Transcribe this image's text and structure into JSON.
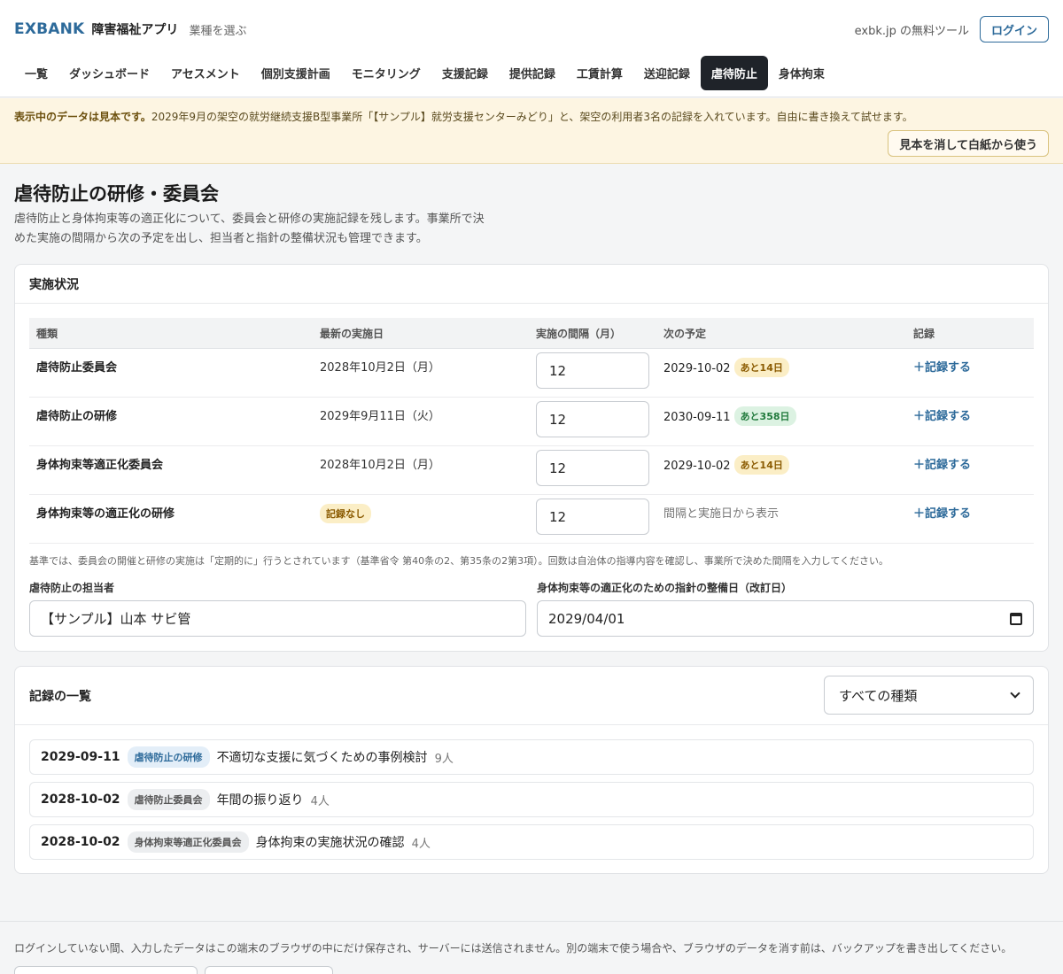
{
  "header": {
    "logo": "EXBANK",
    "app_name": "障害福祉アプリ",
    "industry_link": "業種を選ぶ",
    "free_tool": "exbk.jp の無料ツール",
    "login": "ログイン"
  },
  "nav": [
    {
      "label": "一覧"
    },
    {
      "label": "ダッシュボード"
    },
    {
      "label": "アセスメント"
    },
    {
      "label": "個別支援計画"
    },
    {
      "label": "モニタリング"
    },
    {
      "label": "支援記録"
    },
    {
      "label": "提供記録"
    },
    {
      "label": "工賃計算"
    },
    {
      "label": "送迎記録"
    },
    {
      "label": "虐待防止",
      "active": true
    },
    {
      "label": "身体拘束"
    }
  ],
  "notice": {
    "bold": "表示中のデータは見本です。",
    "text": "2029年9月の架空の就労継続支援B型事業所「【サンプル】就労支援センターみどり」と、架空の利用者3名の記録を入れています。自由に書き換えて試せます。",
    "button": "見本を消して白紙から使う"
  },
  "page": {
    "title": "虐待防止の研修・委員会",
    "desc_line1": "虐待防止と身体拘束等の適正化について、委員会と研修の実施記録を残します。事業所で決",
    "desc_line2": "めた実施の間隔から次の予定を出し、担当者と指針の整備状況も管理できます。"
  },
  "status": {
    "title": "実施状況",
    "headers": {
      "type": "種類",
      "latest": "最新の実施日",
      "interval": "実施の間隔（月）",
      "next": "次の予定",
      "record": "記録"
    },
    "rows": [
      {
        "type": "虐待防止委員会",
        "latest": "2028年10月2日（月）",
        "interval": "12",
        "next": "2029-10-02",
        "badge": "あと14日",
        "badge_kind": "warn",
        "record": "＋記録する"
      },
      {
        "type": "虐待防止の研修",
        "latest": "2029年9月11日（火）",
        "interval": "12",
        "next": "2030-09-11",
        "badge": "あと358日",
        "badge_kind": "ok",
        "record": "＋記録する"
      },
      {
        "type": "身体拘束等適正化委員会",
        "latest": "2028年10月2日（月）",
        "interval": "12",
        "next": "2029-10-02",
        "badge": "あと14日",
        "badge_kind": "warn",
        "record": "＋記録する"
      },
      {
        "type": "身体拘束等の適正化の研修",
        "latest_badge": "記録なし",
        "interval": "12",
        "next_placeholder": "間隔と実施日から表示",
        "record": "＋記録する"
      }
    ],
    "note": "基準では、委員会の開催と研修の実施は「定期的に」行うとされています（基準省令 第40条の2、第35条の2第3項）。回数は自治体の指導内容を確認し、事業所で決めた間隔を入力してください。",
    "manager_label": "虐待防止の担当者",
    "manager_value": "【サンプル】山本 サビ管",
    "guideline_label": "身体拘束等の適正化のための指針の整備日（改訂日）",
    "guideline_value": "2029/04/01"
  },
  "records": {
    "title": "記録の一覧",
    "filter": "すべての種類",
    "items": [
      {
        "date": "2029-09-11",
        "tag": "虐待防止の研修",
        "tag_kind": "blue",
        "title": "不適切な支援に気づくための事例検討",
        "count": "9人"
      },
      {
        "date": "2028-10-02",
        "tag": "虐待防止委員会",
        "tag_kind": "gray",
        "title": "年間の振り返り",
        "count": "4人"
      },
      {
        "date": "2028-10-02",
        "tag": "身体拘束等適正化委員会",
        "tag_kind": "gray",
        "title": "身体拘束の実施状況の確認",
        "count": "4人"
      }
    ]
  },
  "footer": {
    "text": "ログインしていない間、入力したデータはこの端末のブラウザの中にだけ保存され、サーバーには送信されません。別の端末で使う場合や、ブラウザのデータを消す前は、バックアップを書き出してください。"
  },
  "colors": {
    "brand": "#2d6a9a",
    "nav_active": "#1f2329",
    "notice_bg": "#fdf5e2"
  }
}
